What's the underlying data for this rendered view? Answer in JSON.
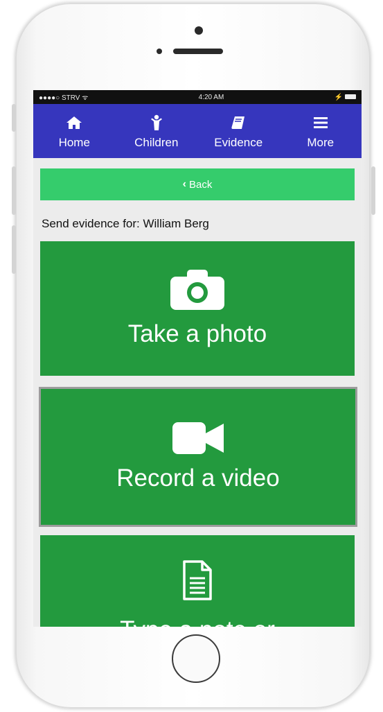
{
  "statusbar": {
    "carrier": "●●●●○ STRV ᯤ",
    "time": "4:20 AM",
    "right": "⚡"
  },
  "nav": {
    "items": [
      {
        "label": "Home",
        "icon": "home-icon"
      },
      {
        "label": "Children",
        "icon": "child-icon"
      },
      {
        "label": "Evidence",
        "icon": "book-icon"
      },
      {
        "label": "More",
        "icon": "menu-icon"
      }
    ],
    "color": "#3636bd"
  },
  "back_label": "Back",
  "send_label": "Send evidence for: William Berg",
  "tiles": [
    {
      "label": "Take a photo",
      "icon": "camera-icon"
    },
    {
      "label": "Record a video",
      "icon": "video-camera-icon"
    },
    {
      "label": "Type a note or",
      "icon": "document-icon"
    }
  ],
  "colors": {
    "tile": "#239a3e",
    "back": "#35cc6c"
  }
}
